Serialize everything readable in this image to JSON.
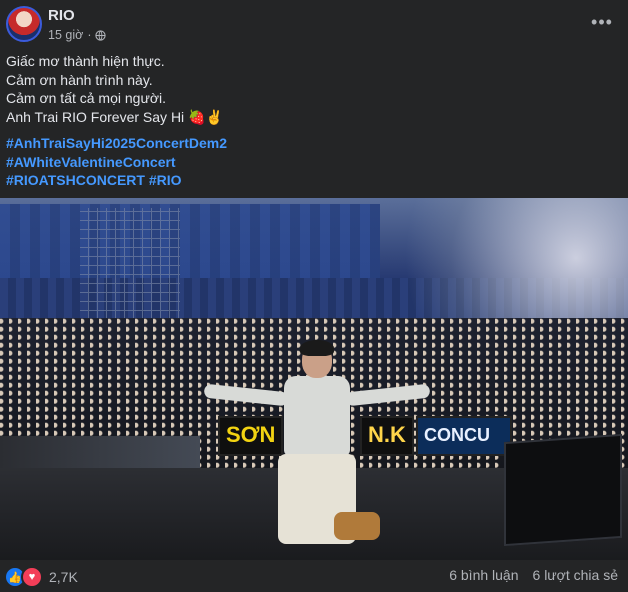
{
  "post": {
    "author": "RIO",
    "time": "15 giờ",
    "privacy_icon": "globe-icon",
    "more_icon": "more-icon"
  },
  "caption": {
    "lines": [
      "Giấc mơ thành hiện thực.",
      "Cảm ơn hành trình này.",
      "Cảm ơn tất cả mọi người.",
      "Anh Trai RIO Forever Say Hi 🍓✌️"
    ]
  },
  "hashtags": {
    "line1": "#AnhTraiSayHi2025ConcertDem2",
    "line2": "#AWhiteValentineConcert",
    "line3_a": "#RIOATSHCONCERT",
    "line3_b": "#RIO"
  },
  "photo": {
    "banner_1": "SƠN",
    "banner_2": "N.K",
    "banner_3": "CONCU"
  },
  "footer": {
    "reaction_icons": [
      "like-icon",
      "love-icon"
    ],
    "reaction_count": "2,7K",
    "comments": "6 bình luận",
    "shares": "6 lượt chia sẻ"
  },
  "colors": {
    "background": "#242526",
    "text_primary": "#e4e6eb",
    "text_secondary": "#b0b3b8",
    "hashtag": "#4599ff",
    "like": "#1877f2",
    "love": "#f33e58"
  }
}
